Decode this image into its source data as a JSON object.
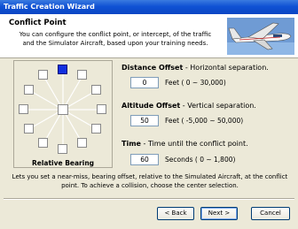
{
  "window": {
    "title": "Traffic Creation Wizard"
  },
  "header": {
    "title": "Conflict Point",
    "description": "You can configure the conflict point, or intercept, of the traffic and the Simulator Aircraft, based upon your training needs."
  },
  "bearing": {
    "label": "Relative Bearing",
    "selected": "north"
  },
  "distance": {
    "title": "Distance Offset",
    "desc": " - Horizontal separation.",
    "value": "0",
    "unit": "Feet ( 0 ~ 30,000)"
  },
  "altitude": {
    "title": "Altitude Offset",
    "desc": " - Vertical separation.",
    "value": "50",
    "unit": "Feet ( -5,000 ~ 50,000)"
  },
  "time": {
    "title": "Time",
    "desc": " - Time until the conflict point.",
    "value": "60",
    "unit": "Seconds ( 0 ~ 1,800)"
  },
  "footer": {
    "text": "Lets you set a near-miss, bearing offset, relative to the Simulated Aircraft, at the conflict point. To achieve a collision, choose the center selection."
  },
  "buttons": {
    "back": "< Back",
    "next": "Next >",
    "cancel": "Cancel"
  },
  "colors": {
    "selected": "#1030e0",
    "titlebar": "#0a46c4"
  },
  "icons": {
    "header_image": "airplane-icon"
  }
}
